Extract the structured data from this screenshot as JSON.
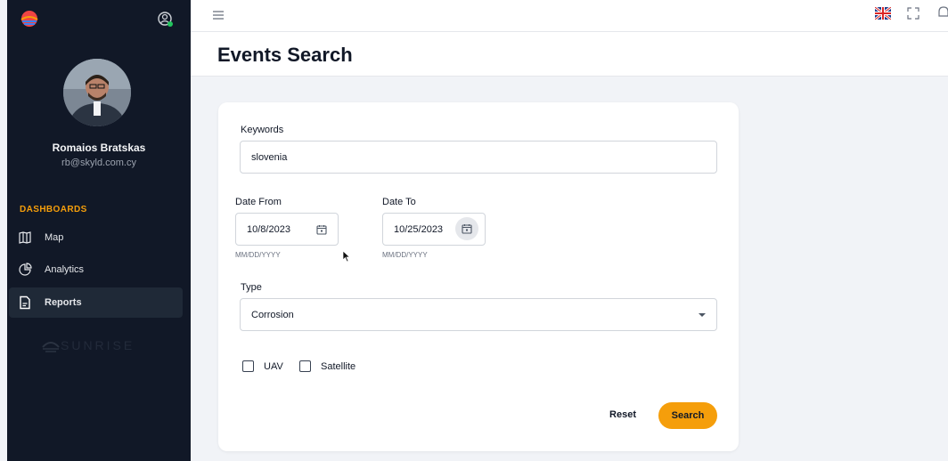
{
  "sidebar": {
    "user": {
      "name": "Romaios Bratskas",
      "email": "rb@skyld.com.cy"
    },
    "section_title": "DASHBOARDS",
    "items": [
      {
        "label": "Map",
        "icon": "map-icon"
      },
      {
        "label": "Analytics",
        "icon": "analytics-icon"
      },
      {
        "label": "Reports",
        "icon": "file-icon",
        "active": true
      }
    ],
    "brand": "SUNRISE"
  },
  "topbar": {
    "language": "EN"
  },
  "page": {
    "title": "Events Search"
  },
  "form": {
    "keywords": {
      "label": "Keywords",
      "value": "slovenia"
    },
    "date_from": {
      "label": "Date From",
      "value": "10/8/2023",
      "hint": "MM/DD/YYYY"
    },
    "date_to": {
      "label": "Date To",
      "value": "10/25/2023",
      "hint": "MM/DD/YYYY"
    },
    "type": {
      "label": "Type",
      "value": "Corrosion"
    },
    "checkboxes": [
      {
        "label": "UAV",
        "checked": false
      },
      {
        "label": "Satellite",
        "checked": false
      }
    ],
    "reset_label": "Reset",
    "search_label": "Search"
  },
  "colors": {
    "sidebar_bg": "#111827",
    "accent": "#f59e0b",
    "page_bg": "#f1f3f7"
  }
}
